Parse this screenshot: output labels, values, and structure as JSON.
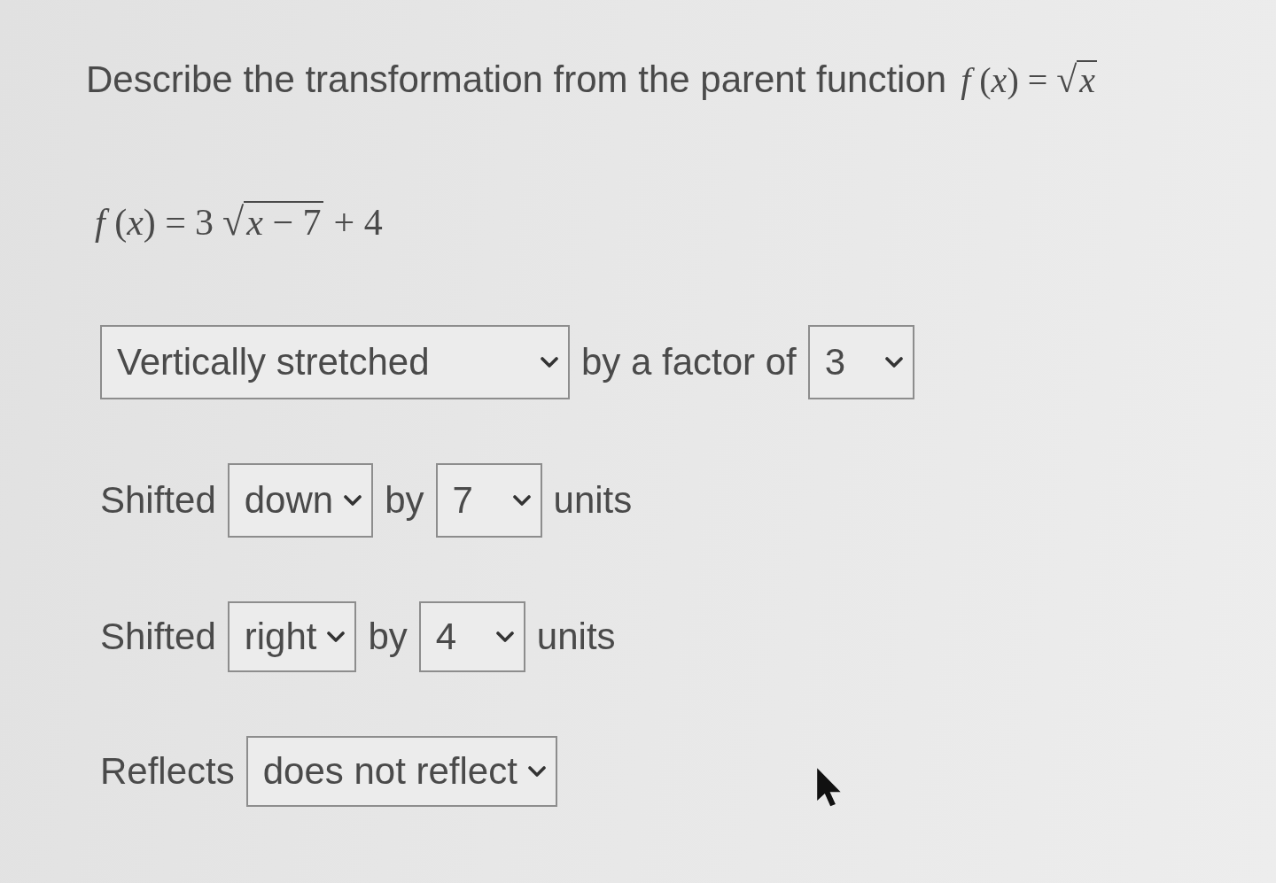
{
  "prompt": {
    "text": "Describe the transformation from the parent function",
    "formula": {
      "lhs": "*f* (*x*) =",
      "radical": "√",
      "radicand": "*x*"
    }
  },
  "equation": {
    "lhs": "*f* (*x*) =",
    "coefficient": "3",
    "radical": "√",
    "radicand": "*x* − 7",
    "constant": "+ 4"
  },
  "rows": [
    {
      "items": [
        {
          "kind": "select",
          "value": "Vertically stretched"
        },
        {
          "kind": "text",
          "text": "by a factor of"
        },
        {
          "kind": "select",
          "value": "3"
        }
      ]
    },
    {
      "items": [
        {
          "kind": "text",
          "text": "Shifted"
        },
        {
          "kind": "select",
          "value": "down"
        },
        {
          "kind": "text",
          "text": "by"
        },
        {
          "kind": "select",
          "value": "7"
        },
        {
          "kind": "text",
          "text": "units"
        }
      ]
    },
    {
      "items": [
        {
          "kind": "text",
          "text": "Shifted"
        },
        {
          "kind": "select",
          "value": "right"
        },
        {
          "kind": "text",
          "text": "by"
        },
        {
          "kind": "select",
          "value": "4"
        },
        {
          "kind": "text",
          "text": "units"
        }
      ]
    },
    {
      "items": [
        {
          "kind": "text",
          "text": "Reflects"
        },
        {
          "kind": "select",
          "value": "does not reflect"
        }
      ]
    }
  ]
}
